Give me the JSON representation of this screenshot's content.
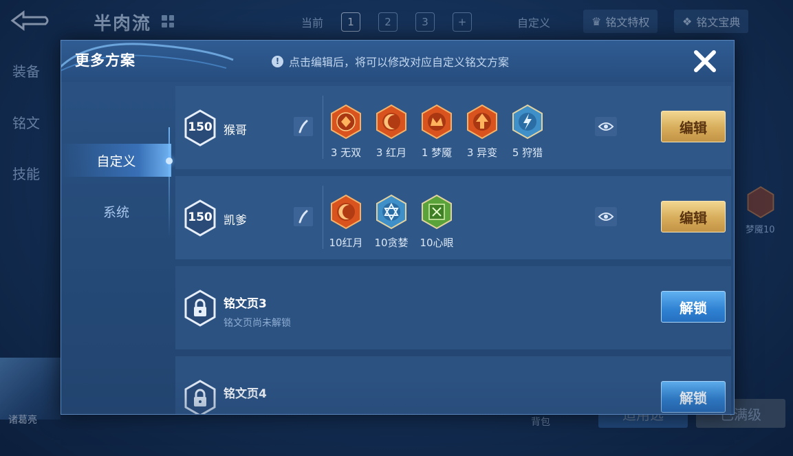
{
  "background": {
    "title": "半肉流",
    "tabs": {
      "current_label": "当前",
      "pages": [
        "1",
        "2",
        "3"
      ],
      "add": "+"
    },
    "custom_label": "自定义",
    "privilege_label": "铭文特权",
    "handbook_label": "铭文宝典",
    "side_nav": [
      "装备",
      "铭文",
      "技能"
    ],
    "side_rune_label": "梦魇10",
    "hero_name": "诸葛亮",
    "bag_label": "背包",
    "bottom_left_label": "适用选",
    "bottom_right_label": "已满级"
  },
  "modal": {
    "title": "更多方案",
    "hint": "点击编辑后，将可以修改对应自定义铭文方案",
    "sidebar": [
      {
        "label": "自定义",
        "active": true
      },
      {
        "label": "系统",
        "active": false
      }
    ],
    "pages": [
      {
        "level": "150",
        "name": "猴哥",
        "edit_label": "编辑",
        "runes": [
          {
            "label": "3 无双",
            "icon": "wushuang-rune-icon",
            "color": "#d9531f"
          },
          {
            "label": "3 红月",
            "icon": "hongyue-rune-icon",
            "color": "#d9531f"
          },
          {
            "label": "1 梦魇",
            "icon": "mengyan-rune-icon",
            "color": "#d9531f"
          },
          {
            "label": "3 异变",
            "icon": "yibian-rune-icon",
            "color": "#d9531f"
          },
          {
            "label": "5 狩猎",
            "icon": "shoulie-rune-icon",
            "color": "#3f8fc9"
          }
        ]
      },
      {
        "level": "150",
        "name": "凯爹",
        "edit_label": "编辑",
        "runes": [
          {
            "label": "10红月",
            "icon": "hongyue-rune-icon",
            "color": "#d9531f"
          },
          {
            "label": "10贪婪",
            "icon": "tanlan-rune-icon",
            "color": "#3f8fc9"
          },
          {
            "label": "10心眼",
            "icon": "xinyan-rune-icon",
            "color": "#5aa33a"
          }
        ]
      },
      {
        "name": "铭文页3",
        "status": "铭文页尚未解锁",
        "unlock_label": "解锁"
      },
      {
        "name": "铭文页4",
        "unlock_label": "解锁"
      }
    ]
  }
}
